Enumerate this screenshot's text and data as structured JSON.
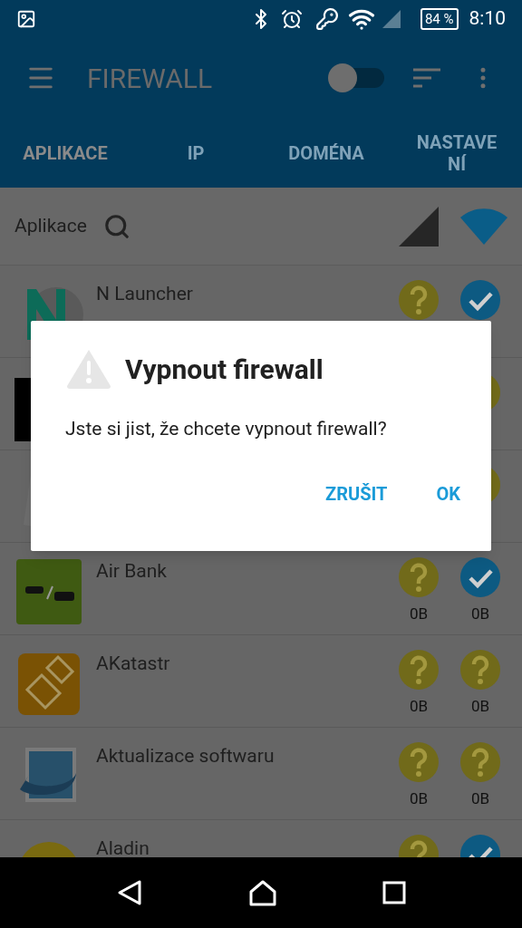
{
  "status_bar": {
    "battery": "84 %",
    "time": "8:10"
  },
  "app_bar": {
    "title": "FIREWALL",
    "firewall_switch": {
      "on": false
    }
  },
  "tabs": [
    {
      "label": "APLIKACE",
      "selected": true
    },
    {
      "label": "IP",
      "selected": false
    },
    {
      "label": "DOMÉNA",
      "selected": false
    },
    {
      "label": "NASTAVENÍ",
      "selected": false
    }
  ],
  "filter": {
    "label": "Aplikace"
  },
  "apps": [
    {
      "name": "N Launcher",
      "mobile_allowed": false,
      "wifi_allowed": true
    },
    {
      "wifi_allowed": false
    },
    {
      "wifi_allowed": false
    },
    {
      "name": "Air Bank",
      "mobile_allowed": false,
      "wifi_allowed": true,
      "mobile_usage": "0B",
      "wifi_usage": "0B"
    },
    {
      "name": "AKatastr",
      "mobile_allowed": false,
      "wifi_allowed": false,
      "mobile_usage": "0B",
      "wifi_usage": "0B"
    },
    {
      "name": "Aktualizace softwaru",
      "mobile_allowed": false,
      "wifi_allowed": false,
      "mobile_usage": "0B",
      "wifi_usage": "0B"
    },
    {
      "name": "Aladin",
      "mobile_allowed": false,
      "wifi_allowed": true
    }
  ],
  "dialog": {
    "title": "Vypnout firewall",
    "message": "Jste si jist, že chcete vypnout firewall?",
    "buttons": [
      "ZRUŠIT",
      "OK"
    ]
  }
}
